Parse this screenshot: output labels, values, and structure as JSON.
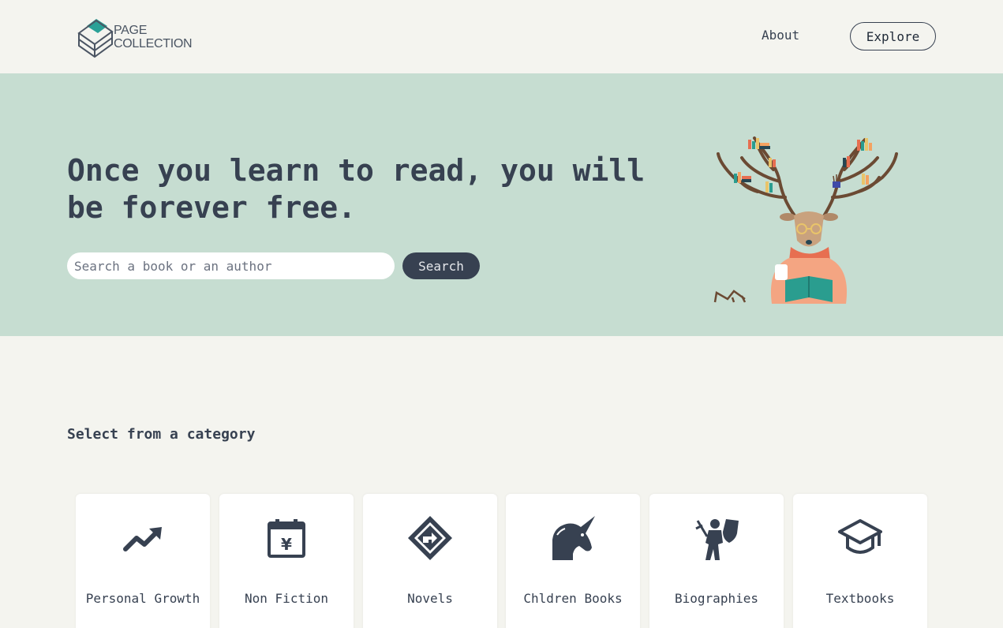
{
  "header": {
    "logo_line1": "PAGE",
    "logo_line2": "COLLECTION",
    "nav_about": "About",
    "nav_explore": "Explore"
  },
  "hero": {
    "headline": "Once you learn to read, you will be forever free.",
    "search_placeholder": "Search a book or an author",
    "search_button": "Search"
  },
  "categories": {
    "title": "Select from a category",
    "items": [
      {
        "label": "Personal Growth",
        "icon": "trending-up-icon"
      },
      {
        "label": "Non Fiction",
        "icon": "calendar-yen-icon"
      },
      {
        "label": "Novels",
        "icon": "diamond-emblem-icon"
      },
      {
        "label": "Chldren Books",
        "icon": "unicorn-icon"
      },
      {
        "label": "Biographies",
        "icon": "knight-icon"
      },
      {
        "label": "Textbooks",
        "icon": "graduation-cap-icon"
      }
    ]
  },
  "colors": {
    "background": "#f4f4ef",
    "hero": "#c6ddd1",
    "dark": "#374151",
    "card": "#ffffff",
    "logo_accent": "#2aa197"
  }
}
